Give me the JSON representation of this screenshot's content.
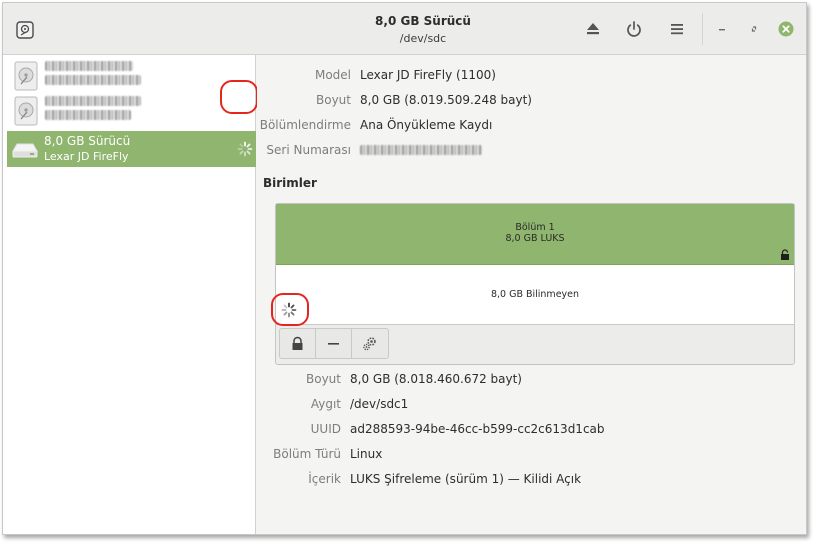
{
  "window": {
    "title": "8,0 GB Sürücü",
    "subtitle": "/dev/sdc"
  },
  "header": {
    "left_icon": "disks-app-icon",
    "actions": [
      "eject-icon",
      "power-icon",
      "menu-icon"
    ],
    "window_controls": [
      "minimize-icon",
      "maximize-icon",
      "close-icon"
    ],
    "close_color": "#8fb56f"
  },
  "sidebar": {
    "items": [
      {
        "name_redacted": true,
        "icon": "harddisk-icon"
      },
      {
        "name_redacted": true,
        "icon": "harddisk-icon"
      },
      {
        "name": "8,0 GB Sürücü",
        "sub": "Lexar JD FireFly",
        "icon": "usb-drive-icon",
        "selected": true,
        "busy": true
      }
    ]
  },
  "drive": {
    "labels": {
      "model": "Model",
      "size": "Boyut",
      "partitioning": "Bölümlendirme",
      "serial": "Seri Numarası"
    },
    "values": {
      "model": "Lexar JD FireFly (1100)",
      "size": "8,0 GB (8.019.509.248 bayt)",
      "partitioning": "Ana Önyükleme Kaydı"
    }
  },
  "volumes": {
    "title": "Birimler",
    "partition_name": "Bölüm 1",
    "partition_desc": "8,0 GB LUKS",
    "free_desc": "8,0 GB Bilinmeyen",
    "accent": "#8fb56f"
  },
  "volume_details": {
    "labels": {
      "size": "Boyut",
      "device": "Aygıt",
      "uuid": "UUID",
      "type": "Bölüm Türü",
      "contents": "İçerik"
    },
    "values": {
      "size": "8,0 GB (8.018.460.672 bayt)",
      "device": "/dev/sdc1",
      "uuid": "ad288593-94be-46cc-b599-cc2c613d1cab",
      "type": "Linux",
      "contents": "LUKS Şifreleme (sürüm 1) — Kilidi Açık"
    }
  },
  "annotations": {
    "highlight_color": "#e3271f"
  }
}
